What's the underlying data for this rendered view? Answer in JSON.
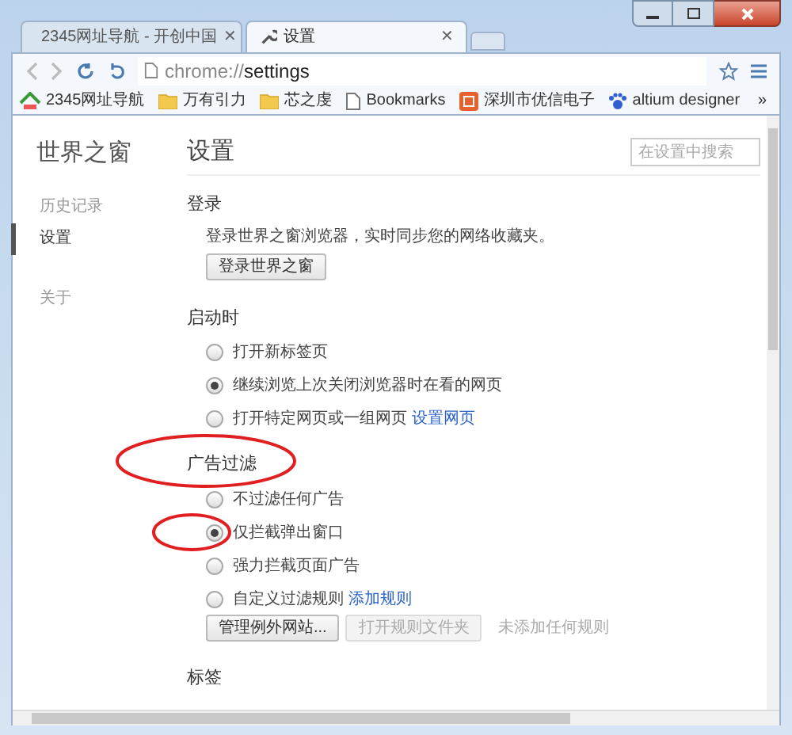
{
  "tabs": [
    {
      "label": "2345网址导航 - 开创中国",
      "selected": false
    },
    {
      "label": "设置",
      "selected": true
    }
  ],
  "tab_close": "✕",
  "address": {
    "scheme": "chrome://",
    "path": "settings"
  },
  "bookmarks": [
    {
      "label": "2345网址导航",
      "kind": "site"
    },
    {
      "label": "万有引力",
      "kind": "folder"
    },
    {
      "label": "芯之虔",
      "kind": "folder"
    },
    {
      "label": "Bookmarks",
      "kind": "page"
    },
    {
      "label": "深圳市优信电子",
      "kind": "shop"
    },
    {
      "label": "altium designer",
      "kind": "paw"
    }
  ],
  "bookmarks_overflow": "»",
  "sidebar": {
    "title": "世界之窗",
    "items": [
      {
        "label": "历史记录",
        "selected": false
      },
      {
        "label": "设置",
        "selected": true
      },
      {
        "label": "关于",
        "selected": false
      }
    ]
  },
  "main": {
    "title": "设置",
    "search": {
      "placeholder": "在设置中搜索"
    }
  },
  "login": {
    "heading": "登录",
    "description": "登录世界之窗浏览器，实时同步您的网络收藏夹。",
    "button": "登录世界之窗"
  },
  "startup": {
    "heading": "启动时",
    "options": [
      {
        "label": "打开新标签页",
        "selected": false
      },
      {
        "label": "继续浏览上次关闭浏览器时在看的网页",
        "selected": true
      },
      {
        "label": "打开特定网页或一组网页",
        "selected": false,
        "link": "设置网页"
      }
    ]
  },
  "adblock": {
    "heading": "广告过滤",
    "options": [
      {
        "label": "不过滤任何广告",
        "selected": false
      },
      {
        "label": "仅拦截弹出窗口",
        "selected": true
      },
      {
        "label": "强力拦截页面广告",
        "selected": false
      },
      {
        "label": "自定义过滤规则",
        "selected": false,
        "link": "添加规则"
      }
    ],
    "buttons": [
      {
        "label": "管理例外网站...",
        "disabled": false
      },
      {
        "label": "打开规则文件夹",
        "disabled": true
      }
    ],
    "note": "未添加任何规则"
  },
  "tabs_section": {
    "heading": "标签"
  }
}
